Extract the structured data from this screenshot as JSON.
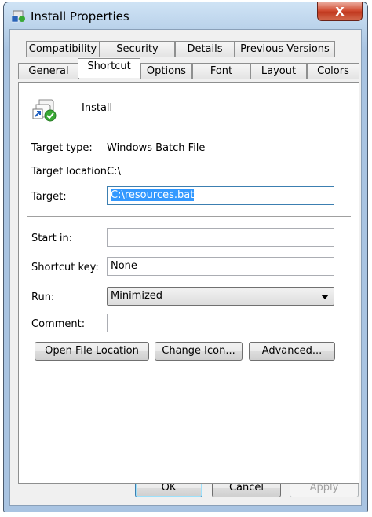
{
  "window": {
    "title": "Install Properties",
    "close_glyph": "X"
  },
  "tabs": {
    "row1": [
      "Compatibility",
      "Security",
      "Details",
      "Previous Versions"
    ],
    "row2": [
      "General",
      "Shortcut",
      "Options",
      "Font",
      "Layout",
      "Colors"
    ],
    "active": "Shortcut"
  },
  "shortcut": {
    "name": "Install",
    "icon": "shortcut-batch-file-icon",
    "target_type_label": "Target type:",
    "target_type_value": "Windows Batch File",
    "target_location_label": "Target location:",
    "target_location_value": "C:\\",
    "target_label": "Target:",
    "target_value": "C:\\resources.bat",
    "start_in_label": "Start in:",
    "start_in_value": "",
    "shortcut_key_label": "Shortcut key:",
    "shortcut_key_value": "None",
    "run_label": "Run:",
    "run_value": "Minimized",
    "comment_label": "Comment:",
    "comment_value": ""
  },
  "buttons": {
    "open_file_location": "Open File Location",
    "change_icon": "Change Icon...",
    "advanced": "Advanced...",
    "ok": "OK",
    "cancel": "Cancel",
    "apply": "Apply"
  },
  "colors": {
    "selection": "#3399ff",
    "close_button": "#c0391f",
    "frame": "#a9c4e2"
  }
}
